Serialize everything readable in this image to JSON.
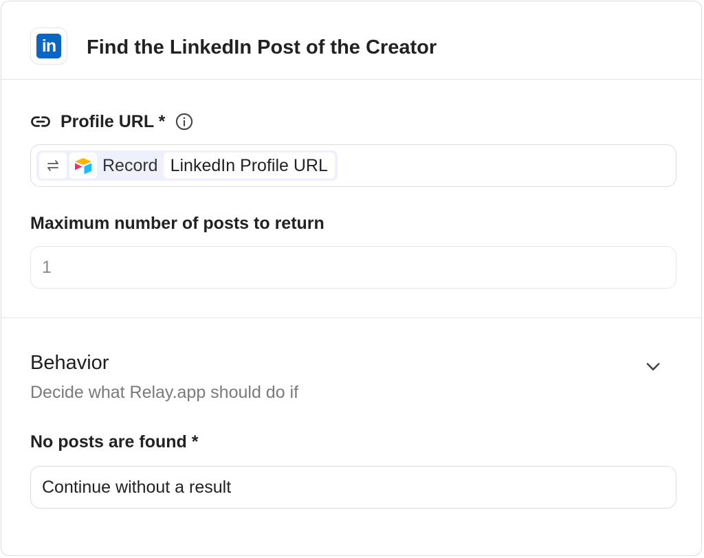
{
  "step": {
    "title": "Find the LinkedIn Post of the Creator",
    "app_icon": "linkedin-icon",
    "app_icon_text": "in",
    "brand_color": "#0a66c2"
  },
  "profile_url": {
    "label": "Profile URL *",
    "label_icon": "link-icon",
    "info_icon": "info-icon",
    "token": {
      "swap_icon": "swap-icon",
      "source_icon": "airtable-icon",
      "source_label": "Record",
      "field_label": "LinkedIn Profile URL"
    }
  },
  "max_posts": {
    "label": "Maximum number of posts to return",
    "placeholder": "1"
  },
  "behavior": {
    "title": "Behavior",
    "subtitle": "Decide what Relay.app should do if",
    "expand_icon": "chevron-down-icon",
    "no_posts": {
      "label": "No posts are found *",
      "value": "Continue without a result"
    }
  }
}
